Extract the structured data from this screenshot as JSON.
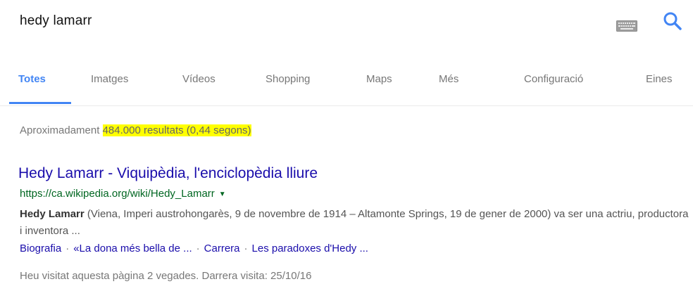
{
  "search": {
    "query": "hedy lamarr",
    "keyboard_icon": "keyboard-icon",
    "search_icon": "search-icon"
  },
  "tabs": [
    {
      "label": "Totes",
      "active": true
    },
    {
      "label": "Imatges"
    },
    {
      "label": "Vídeos"
    },
    {
      "label": "Shopping"
    },
    {
      "label": "Maps"
    },
    {
      "label": "Més"
    },
    {
      "label": "Configuració"
    },
    {
      "label": "Eines"
    }
  ],
  "stats": {
    "prefix": "Aproximadament",
    "highlighted": "484.000 resultats (0,44 segons)"
  },
  "result": {
    "title": "Hedy Lamarr - Viquipèdia, l'enciclopèdia lliure",
    "url": "https://ca.wikipedia.org/wiki/Hedy_Lamarr",
    "snippet_bold": "Hedy Lamarr",
    "snippet_rest": " (Viena, Imperi austrohongarès, 9 de novembre de 1914 – Altamonte Springs, 19 de gener de 2000) va ser una actriu, productora i inventora ...",
    "sitelinks": [
      "Biografia",
      "«La dona més bella de ...",
      "Carrera",
      "Les paradoxes d'Hedy ..."
    ],
    "sitelink_separator": "·",
    "visited": "Heu visitat aquesta pàgina 2 vegades. Darrera visita: 25/10/16"
  },
  "colors": {
    "link": "#1a0dab",
    "url": "#006621",
    "accent": "#4285f4",
    "highlight": "#ffff00"
  }
}
